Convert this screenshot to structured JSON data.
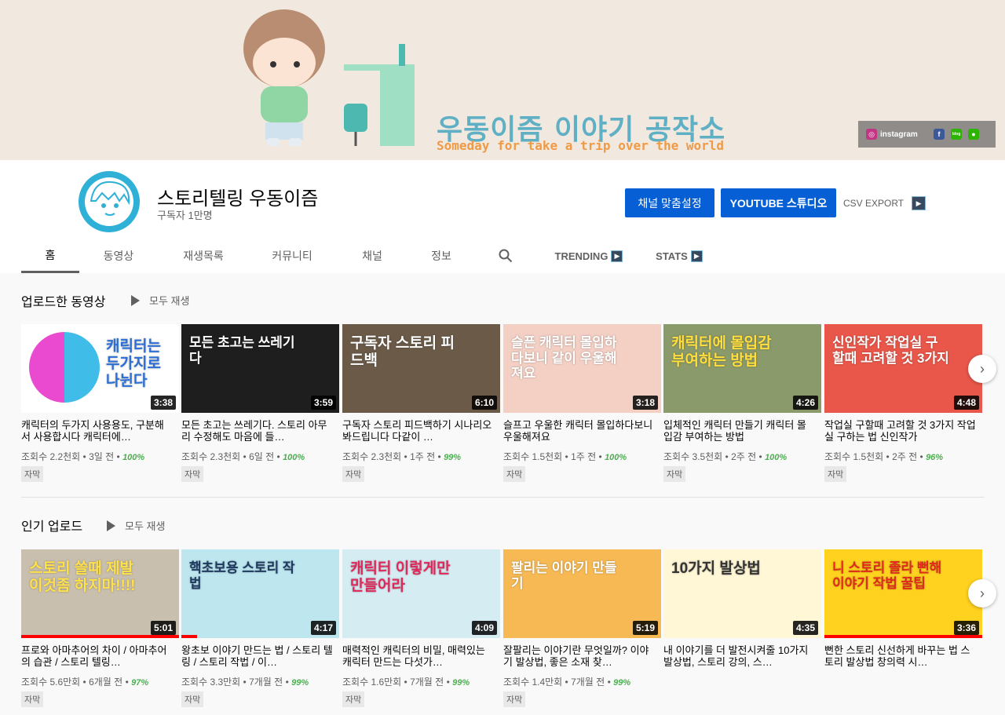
{
  "banner": {
    "title": "우동이즘 이야기 공작소",
    "subtitle": "Someday for take a trip over the world",
    "instagram_label": "instagram",
    "facebook_glyph": "f",
    "blog_glyph": "blog",
    "talk_glyph": "●"
  },
  "channel": {
    "name": "스토리텔링 우동이즘",
    "subscribers": "구독자 1만명",
    "customize_button": "채널 맞춤설정",
    "studio_button": "YOUTUBE 스튜디오",
    "csv_export": "CSV EXPORT"
  },
  "tabs": [
    {
      "label": "홈"
    },
    {
      "label": "동영상"
    },
    {
      "label": "재생목록"
    },
    {
      "label": "커뮤니티"
    },
    {
      "label": "채널"
    },
    {
      "label": "정보"
    },
    {
      "label": "TRENDING"
    },
    {
      "label": "STATS"
    }
  ],
  "sections": [
    {
      "title": "업로드한 동영상",
      "play_all": "모두 재생",
      "videos": [
        {
          "thumb_text": "캐릭터는 두가지로 나뉜다",
          "duration": "3:38",
          "title": "캐릭터의 두가지 사용용도, 구분해서 사용합시다 캐릭터에…",
          "views": "조회수 2.2천회",
          "age": "3일 전",
          "pct": "100%",
          "badge": "자막",
          "bg": "#ffffff",
          "fg": "#2b6fd6"
        },
        {
          "thumb_text": "모든 초고는 쓰레기다",
          "duration": "3:59",
          "title": "모든 초고는 쓰레기다. 스토리 아무리 수정해도 마음에 들…",
          "views": "조회수 2.3천회",
          "age": "6일 전",
          "pct": "100%",
          "badge": "자막",
          "bg": "#1e1e1e",
          "fg": "#ffffff"
        },
        {
          "thumb_text": "구독자 스토리 피드백",
          "duration": "6:10",
          "title": "구독자 스토리 피드백하기 시나리오 봐드립니다 다같이 …",
          "views": "조회수 2.3천회",
          "age": "1주 전",
          "pct": "99%",
          "badge": "자막",
          "bg": "#6b5a48",
          "fg": "#ffffff"
        },
        {
          "thumb_text": "슬픈 캐릭터 몰입하다보니 같이 우울해져요",
          "duration": "3:18",
          "title": "슬프고 우울한 캐릭터 몰입하다보니 우울해져요",
          "views": "조회수 1.5천회",
          "age": "1주 전",
          "pct": "100%",
          "badge": "자막",
          "bg": "#f3cfc4",
          "fg": "#ffffff"
        },
        {
          "thumb_text": "캐릭터에 몰입감 부여하는 방법",
          "duration": "4:26",
          "title": "입체적인 캐릭터 만들기 캐릭터 몰입감 부여하는 방법",
          "views": "조회수 3.5천회",
          "age": "2주 전",
          "pct": "100%",
          "badge": "자막",
          "bg": "#8b9a6a",
          "fg": "#ffde3d"
        },
        {
          "thumb_text": "신인작가 작업실 구할때 고려할 것 3가지",
          "duration": "4:48",
          "title": "작업실 구할때 고려할 것 3가지 작업실 구하는 법 신인작가",
          "views": "조회수 1.5천회",
          "age": "2주 전",
          "pct": "96%",
          "badge": "자막",
          "bg": "#e9574a",
          "fg": "#ffffff"
        }
      ]
    },
    {
      "title": "인기 업로드",
      "play_all": "모두 재생",
      "videos": [
        {
          "thumb_text": "스토리 쓸때 제발 이것좀 하지마!!!!",
          "duration": "5:01",
          "title": "프로와 아마추어의 차이 / 아마추어의 습관 / 스토리 텔링…",
          "views": "조회수 5.6만회",
          "age": "6개월 전",
          "pct": "97%",
          "badge": "자막",
          "bg": "#c9bfae",
          "fg": "#ffe14a"
        },
        {
          "thumb_text": "핵초보용 스토리 작법",
          "duration": "4:17",
          "title": "왕초보 이야기 만드는 법 / 스토리 텔링 / 스토리 작법 / 이…",
          "views": "조회수 3.3만회",
          "age": "7개월 전",
          "pct": "99%",
          "badge": "자막",
          "bg": "#bde6ef",
          "fg": "#1f3a60"
        },
        {
          "thumb_text": "캐릭터 이렇게만 만들어라",
          "duration": "4:09",
          "title": "매력적인 캐릭터의 비밀, 매력있는 캐릭터 만드는 다섯가…",
          "views": "조회수 1.6만회",
          "age": "7개월 전",
          "pct": "99%",
          "badge": "자막",
          "bg": "#d6ecf3",
          "fg": "#e0285a"
        },
        {
          "thumb_text": "팔리는 이야기 만들기",
          "duration": "5:19",
          "title": "잘팔리는 이야기란 무엇일까? 이야기 발상법, 좋은 소재 찾…",
          "views": "조회수 1.4만회",
          "age": "7개월 전",
          "pct": "99%",
          "badge": "자막",
          "bg": "#f6b954",
          "fg": "#ffffff"
        },
        {
          "thumb_text": "10가지 발상법",
          "duration": "4:35",
          "title": "내 이야기를 더 발전시켜줄 10가지 발상법, 스토리 강의, 스…",
          "views": "",
          "age": "",
          "pct": "",
          "badge": "",
          "bg": "#fff7d6",
          "fg": "#333333"
        },
        {
          "thumb_text": "니 스토리 졸라 뻔해 이야기 작법 꿀팁",
          "duration": "3:36",
          "title": "뻔한 스토리 신선하게 바꾸는 법 스토리 발상법 창의력 시…",
          "views": "",
          "age": "",
          "pct": "",
          "badge": "",
          "bg": "#ffd21f",
          "fg": "#e02a1a"
        }
      ]
    }
  ]
}
